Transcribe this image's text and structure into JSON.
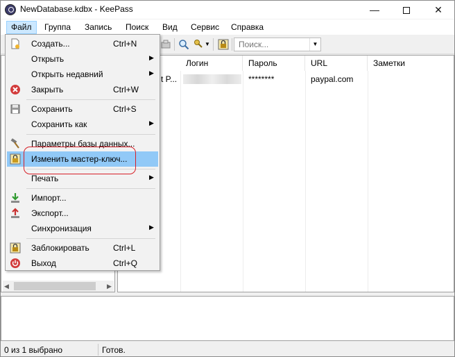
{
  "window": {
    "title": "NewDatabase.kdbx - KeePass",
    "controls": {
      "minimize": "—",
      "close": "✕"
    }
  },
  "menubar": {
    "items": [
      "Файл",
      "Группа",
      "Запись",
      "Поиск",
      "Вид",
      "Сервис",
      "Справка"
    ]
  },
  "toolbar": {
    "search_placeholder": "Поиск...",
    "search_dropdown": "▼"
  },
  "file_menu": {
    "items": [
      {
        "label": "Создать...",
        "shortcut": "Ctrl+N",
        "icon": "new-database-icon"
      },
      {
        "label": "Открыть",
        "submenu": true
      },
      {
        "label": "Открыть недавний",
        "submenu": true
      },
      {
        "label": "Закрыть",
        "shortcut": "Ctrl+W",
        "icon": "close-red-icon"
      },
      {
        "label": "Сохранить",
        "shortcut": "Ctrl+S",
        "icon": "save-disk-icon"
      },
      {
        "label": "Сохранить как",
        "submenu": true
      },
      {
        "label": "Параметры базы данных...",
        "icon": "hammer-icon"
      },
      {
        "label": "Изменить мастер-ключ...",
        "icon": "master-key-icon",
        "highlighted": true
      },
      {
        "label": "Печать",
        "submenu": true
      },
      {
        "label": "Импорт...",
        "icon": "import-arrow-icon"
      },
      {
        "label": "Экспорт...",
        "icon": "export-arrow-icon"
      },
      {
        "label": "Синхронизация",
        "submenu": true
      },
      {
        "label": "Заблокировать",
        "shortcut": "Ctrl+L",
        "icon": "lock-icon"
      },
      {
        "label": "Выход",
        "shortcut": "Ctrl+Q",
        "icon": "power-exit-icon"
      }
    ],
    "submenu_arrow": "▶"
  },
  "entry_list": {
    "columns": [
      "Логин",
      "Пароль",
      "URL",
      "Заметки"
    ],
    "rows": [
      {
        "title_fragment": "t P...",
        "password": "********",
        "url": "paypal.com",
        "notes": ""
      }
    ]
  },
  "hscroll": {
    "left_arrow": "◀",
    "right_arrow": "▶"
  },
  "statusbar": {
    "selection": "0 из 1 выбрано",
    "state": "Готов."
  },
  "colors": {
    "menu_highlight": "#91c9f7",
    "menubar_active": "#cce8ff",
    "annotation_circle": "#d71f27"
  }
}
